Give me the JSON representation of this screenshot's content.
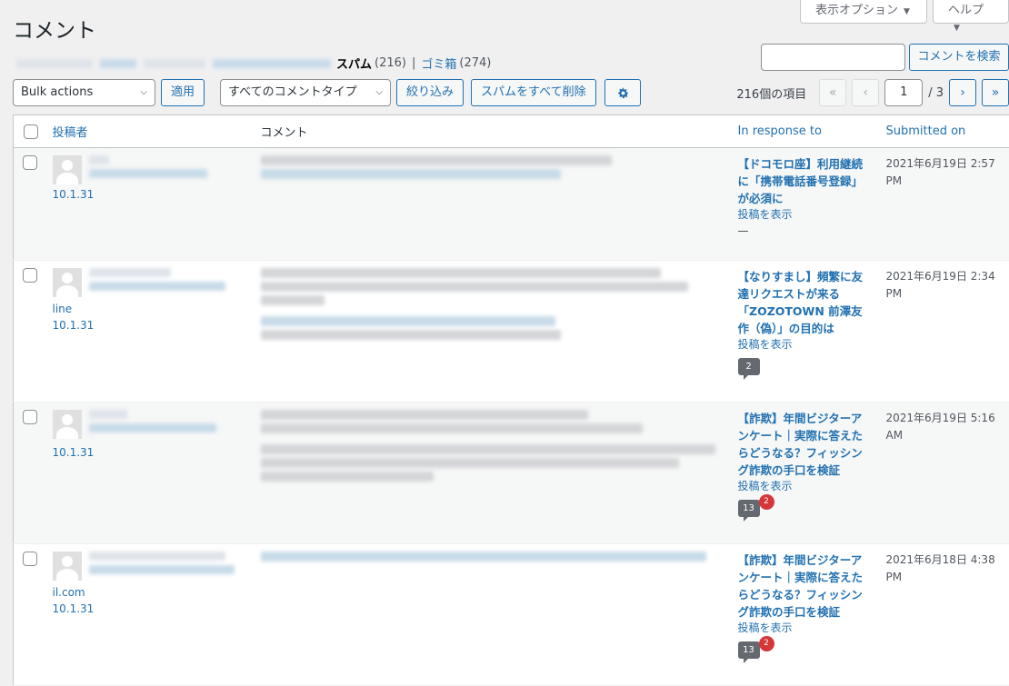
{
  "screen_options": {
    "label": "表示オプション"
  },
  "help": {
    "label": "ヘルプ"
  },
  "page_title": "コメント",
  "views": {
    "spam_label": "スパム",
    "spam_count": "(216)",
    "trash_label": "ゴミ箱",
    "trash_count": "(274)"
  },
  "search": {
    "placeholder": "",
    "button": "コメントを検索"
  },
  "toolbar": {
    "bulk_actions": "Bulk actions",
    "apply": "適用",
    "comment_type": "すべてのコメントタイプ",
    "filter": "絞り込み",
    "empty_spam": "スパムをすべて削除"
  },
  "pagination": {
    "items": "216個の項目",
    "first": "«",
    "prev": "‹",
    "current": "1",
    "total": "/ 3",
    "next": "›",
    "last": "»"
  },
  "table": {
    "columns": {
      "author": "投稿者",
      "comment": "コメント",
      "response": "In response to",
      "submitted": "Submitted on"
    },
    "rows": [
      {
        "author_extra": "",
        "ip": "10.1.31",
        "response_title": "【ドコモロ座】利用継続に「携帯電話番号登録」が必須に",
        "view_post": "投稿を表示",
        "dash": "—",
        "bubble": "",
        "badge": "",
        "date": "2021年6月19日 2:57 PM"
      },
      {
        "author_extra": "line",
        "ip": "10.1.31",
        "response_title": "【なりすまし】頻繁に友達リクエストが来る「ZOZOTOWN 前澤友作（偽）」の目的は",
        "view_post": "投稿を表示",
        "dash": "",
        "bubble": "2",
        "badge": "",
        "date": "2021年6月19日 2:34 PM"
      },
      {
        "author_extra": "",
        "ip": "10.1.31",
        "response_title": "【詐欺】年間ビジターアンケート｜実際に答えたらどうなる？フィッシング詐欺の手口を検証",
        "view_post": "投稿を表示",
        "dash": "",
        "bubble": "13",
        "badge": "2",
        "date": "2021年6月19日 5:16 AM"
      },
      {
        "author_extra": "il.com",
        "ip": "10.1.31",
        "response_title": "【詐欺】年間ビジターアンケート｜実際に答えたらどうなる？フィッシング詐欺の手口を検証",
        "view_post": "投稿を表示",
        "dash": "",
        "bubble": "13",
        "badge": "2",
        "date": "2021年6月18日 4:38 PM"
      }
    ]
  }
}
